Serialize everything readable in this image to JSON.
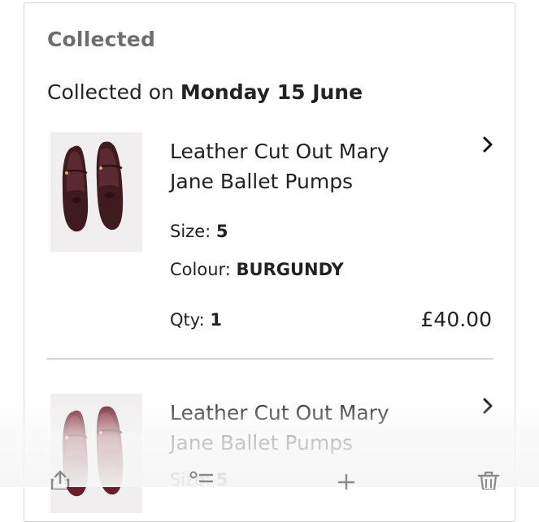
{
  "section": {
    "status_title": "Collected",
    "collected_prefix": "Collected on ",
    "collected_date": "Monday 15 June"
  },
  "items": [
    {
      "name": "Leather Cut Out Mary Jane Ballet Pumps",
      "size_label": "Size: ",
      "size_value": "5",
      "colour_label": "Colour: ",
      "colour_value": "BURGUNDY",
      "qty_label": "Qty: ",
      "qty_value": "1",
      "price": "£40.00",
      "shoe_color": "#4a1c22"
    },
    {
      "name": "Leather Cut Out Mary Jane Ballet Pumps",
      "size_label": "Size: ",
      "size_value": "5",
      "shoe_color": "#6a1a2a"
    }
  ],
  "toolbar": {
    "icons": [
      "share-icon",
      "list-icon",
      "add-icon",
      "trash-icon"
    ]
  },
  "colors": {
    "border": "#d7d7d7",
    "muted_heading": "#6e6e6e",
    "text": "#222222"
  }
}
